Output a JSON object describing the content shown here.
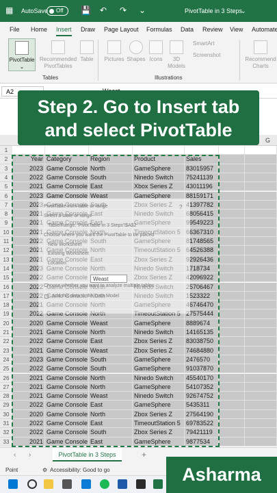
{
  "titlebar": {
    "autosave_label": "AutoSave",
    "toggle_state": "Off",
    "filename": "PivotTable in 3 Steps",
    "filename_caret": "⌄"
  },
  "menu": [
    "File",
    "Home",
    "Insert",
    "Draw",
    "Page Layout",
    "Formulas",
    "Data",
    "Review",
    "View",
    "Automate"
  ],
  "ribbon": {
    "pivot": "PivotTable",
    "recommended": [
      "Recommended",
      "PivotTables"
    ],
    "table": "Table",
    "pictures": "Pictures",
    "shapes": "Shapes",
    "icons": "Icons",
    "models": [
      "3D",
      "Models"
    ],
    "smartart": "SmartArt",
    "screenshot": "Screenshot",
    "rec_charts": [
      "Recommend",
      "Charts"
    ],
    "groups": {
      "tables": "Tables",
      "illustrations": "Illustrations"
    }
  },
  "formula_bar": {
    "cell": "A2",
    "value": "Weast"
  },
  "banner": [
    "Step 2. Go to Insert tab",
    "and select PivotTable"
  ],
  "col_headers": {
    "g": "G"
  },
  "headers": [
    "Year",
    "Category",
    "Region",
    "Product",
    "Sales"
  ],
  "rows": [
    [
      "2023",
      "Game Console",
      "North",
      "GameSphere",
      "83015957"
    ],
    [
      "2022",
      "Game Console",
      "South",
      "Ninedo Switch",
      "75241139"
    ],
    [
      "2021",
      "Game Console",
      "East",
      "Xbox Series Z",
      "43011196"
    ],
    [
      "2023",
      "Game Console",
      "Weast",
      "GameSphere",
      "88159171"
    ],
    [
      "2023",
      "Game Console",
      "South",
      "Zbox Series Z",
      "41397782"
    ],
    [
      "2021",
      "Game Console",
      "East",
      "Ninedo Switch",
      "68056415"
    ],
    [
      "2021",
      "Game Console",
      "East",
      "GameSphere",
      "99549223"
    ],
    [
      "2021",
      "Game Console",
      "North",
      "TimeoutStation 5",
      "66367310"
    ],
    [
      "2022",
      "Game Console",
      "South",
      "GameSphere",
      "81748565"
    ],
    [
      "2021",
      "Game Console",
      "North",
      "TimeoutStation 5",
      "64526388"
    ],
    [
      "2021",
      "Game Console",
      "East",
      "Zbox Series Z",
      "92926436"
    ],
    [
      "2023",
      "Game Console",
      "North",
      "Ninedo Switch",
      "1718734"
    ],
    [
      "2022",
      "Game Console",
      "Weast",
      "Zbox Series Z",
      "42096922"
    ],
    [
      "2022",
      "Game Console",
      "North",
      "Ninedo Switch",
      "25706467"
    ],
    [
      "2022",
      "Game Console",
      "North",
      "Ninedo Switch",
      "1523322"
    ],
    [
      "2021",
      "Game Console",
      "North",
      "GameSphere",
      "46746470"
    ],
    [
      "2022",
      "Game Console",
      "North",
      "TimeoutStation 5",
      "27575444"
    ],
    [
      "2020",
      "Game Console",
      "Weast",
      "GameSphere",
      "8889674"
    ],
    [
      "2021",
      "Game Console",
      "North",
      "Ninedo Switch",
      "14165135"
    ],
    [
      "2022",
      "Game Console",
      "East",
      "Zbox Series Z",
      "83038750"
    ],
    [
      "2021",
      "Game Console",
      "Weast",
      "Zbox Series Z",
      "74684880"
    ],
    [
      "2023",
      "Game Console",
      "South",
      "GameSphere",
      "2476570"
    ],
    [
      "2022",
      "Game Console",
      "South",
      "GameSphere",
      "91037870"
    ],
    [
      "2021",
      "Game Console",
      "North",
      "Ninedo Switch",
      "45540170"
    ],
    [
      "2021",
      "Game Console",
      "North",
      "GameSphere",
      "54107352"
    ],
    [
      "2021",
      "Game Console",
      "Weast",
      "Ninedo Switch",
      "92674752"
    ],
    [
      "2022",
      "Game Console",
      "East",
      "GameSphere",
      "5435311"
    ],
    [
      "2020",
      "Game Console",
      "North",
      "Zbox Series Z",
      "27564190"
    ],
    [
      "2022",
      "Game Console",
      "East",
      "TimeoutStation 5",
      "69783522"
    ],
    [
      "2022",
      "Game Console",
      "South",
      "Zbox Series Z",
      "79421119"
    ],
    [
      "2021",
      "Game Console",
      "East",
      "GameSphere",
      "9877534"
    ]
  ],
  "dialog": {
    "line1": "PivotTable from table or range",
    "line2": "Select a table or range",
    "line3": "Table/Range: 'PivotTable in 3 Steps'!$A$2",
    "line4": "Choose where you want the PivotTable to be placed",
    "line5": "New Worksheet",
    "line6": "Existing Worksheet",
    "line7": "Location:",
    "line8": "Choose whether you want to analyze multiple tables",
    "line9": "Add this data to the Data Model",
    "input": "Weast",
    "help": "?"
  },
  "sheet_tab": "PivotTable in 3 Steps",
  "nav": {
    "prev": "‹",
    "next": "›",
    "add": "+"
  },
  "status": {
    "mode": "Point",
    "accessibility": "Accessibility: Good to go"
  },
  "brand": "Asharma",
  "colors": {
    "excel_green": "#217346",
    "banner_green": "#1f6f42"
  }
}
